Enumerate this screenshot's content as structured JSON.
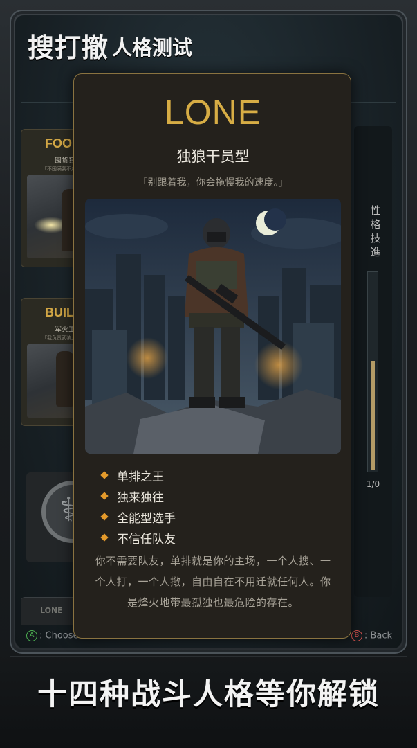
{
  "header": {
    "title": "搜打撤",
    "subtitle": "人格测试"
  },
  "list": {
    "cards": [
      {
        "label": "FOOD",
        "sub": "囤货狂",
        "tagline": "「不囤满我不走」"
      },
      {
        "label": "BUILD",
        "sub": "军火工程",
        "tagline": "「我负责武装」"
      }
    ],
    "peek_label": "LONE"
  },
  "progress": {
    "label": "性格技進",
    "count": "1/0",
    "fill_fraction": 0.55
  },
  "hints": {
    "choose": ": Choose",
    "back": ": Back",
    "a_key": "A",
    "b_key": "B"
  },
  "modal": {
    "code": "LONE",
    "name": "独狼干员型",
    "quote": "「别跟着我，你会拖慢我的速度。」",
    "traits": [
      "单排之王",
      "独来独往",
      "全能型选手",
      "不信任队友"
    ],
    "description": "你不需要队友，单排就是你的主场，一个人搜、一个人打，一个人撤，自由自在不用迁就任何人。你是烽火地带最孤独也最危险的存在。"
  },
  "promo": {
    "text": "十四种战斗人格等你解锁"
  },
  "colors": {
    "accent": "#d7ad45",
    "bullet": "#e49a2b",
    "panel": "#24211c"
  }
}
